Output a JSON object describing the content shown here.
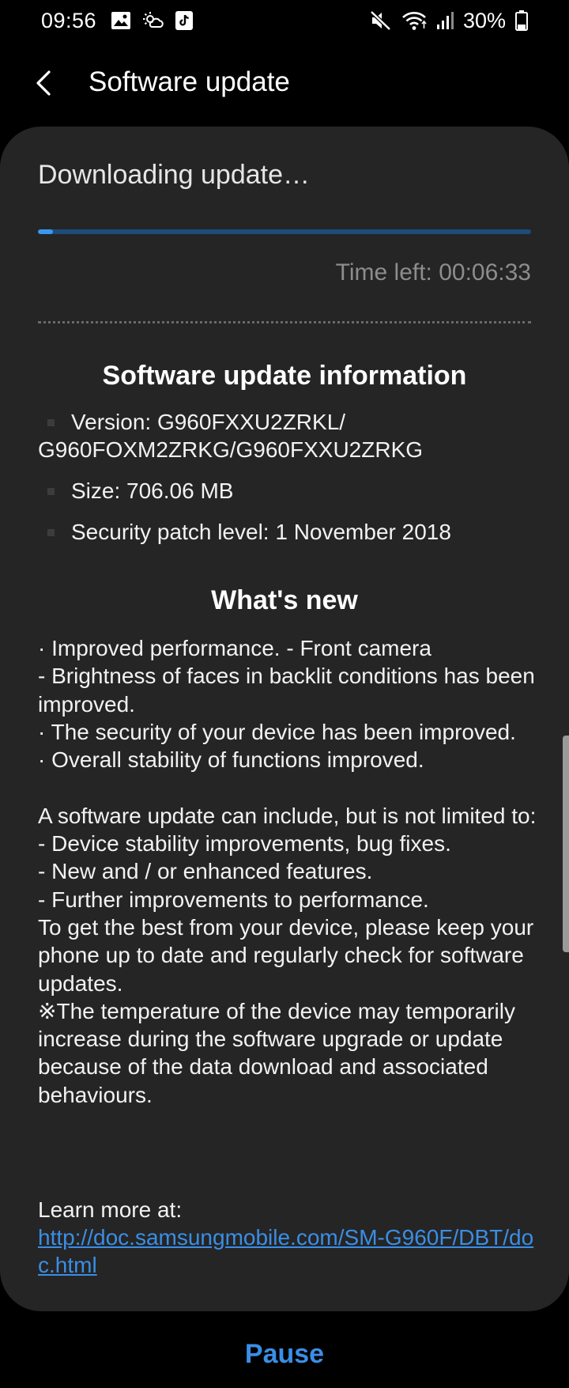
{
  "status_bar": {
    "time": "09:56",
    "battery": "30%",
    "battery_level": 0.3,
    "icons": [
      "image-icon",
      "weather-icon",
      "tiktok-icon",
      "mute-icon",
      "wifi-icon",
      "signal-icon",
      "battery-icon"
    ]
  },
  "header": {
    "title": "Software update",
    "back_icon": "chevron-left-icon"
  },
  "download": {
    "status": "Downloading update…",
    "progress": 0.03,
    "time_left": "Time left: 00:06:33"
  },
  "info": {
    "title": "Software update information",
    "items": [
      "Version: G960FXXU2ZRKL/\nG960FOXM2ZRKG/G960FXXU2ZRKG",
      "Size: 706.06 MB",
      "Security patch level: 1 November 2018"
    ]
  },
  "whats_new": {
    "title": "What's new",
    "body": "· Improved performance. - Front camera\n - Brightness of faces in backlit conditions has been improved.\n· The security of your device has been improved.\n· Overall stability of functions improved.\n\nA software update can include, but is not limited to:\n - Device stability improvements, bug fixes.\n - New and / or enhanced features.\n - Further improvements to performance.\nTo get the best from your device, please keep your phone up to date and regularly check for software updates.\n※The temperature of the device may temporarily increase during the software upgrade or update because of the data download and associated behaviours.",
    "learn_more_label": "Learn more at:",
    "learn_more_link": "http://doc.samsungmobile.com/SM-G960F/DBT/doc.html"
  },
  "actions": {
    "pause_label": "Pause"
  },
  "colors": {
    "accent": "#3a8ee6",
    "card_background": "#252525",
    "page_background": "#000000"
  }
}
